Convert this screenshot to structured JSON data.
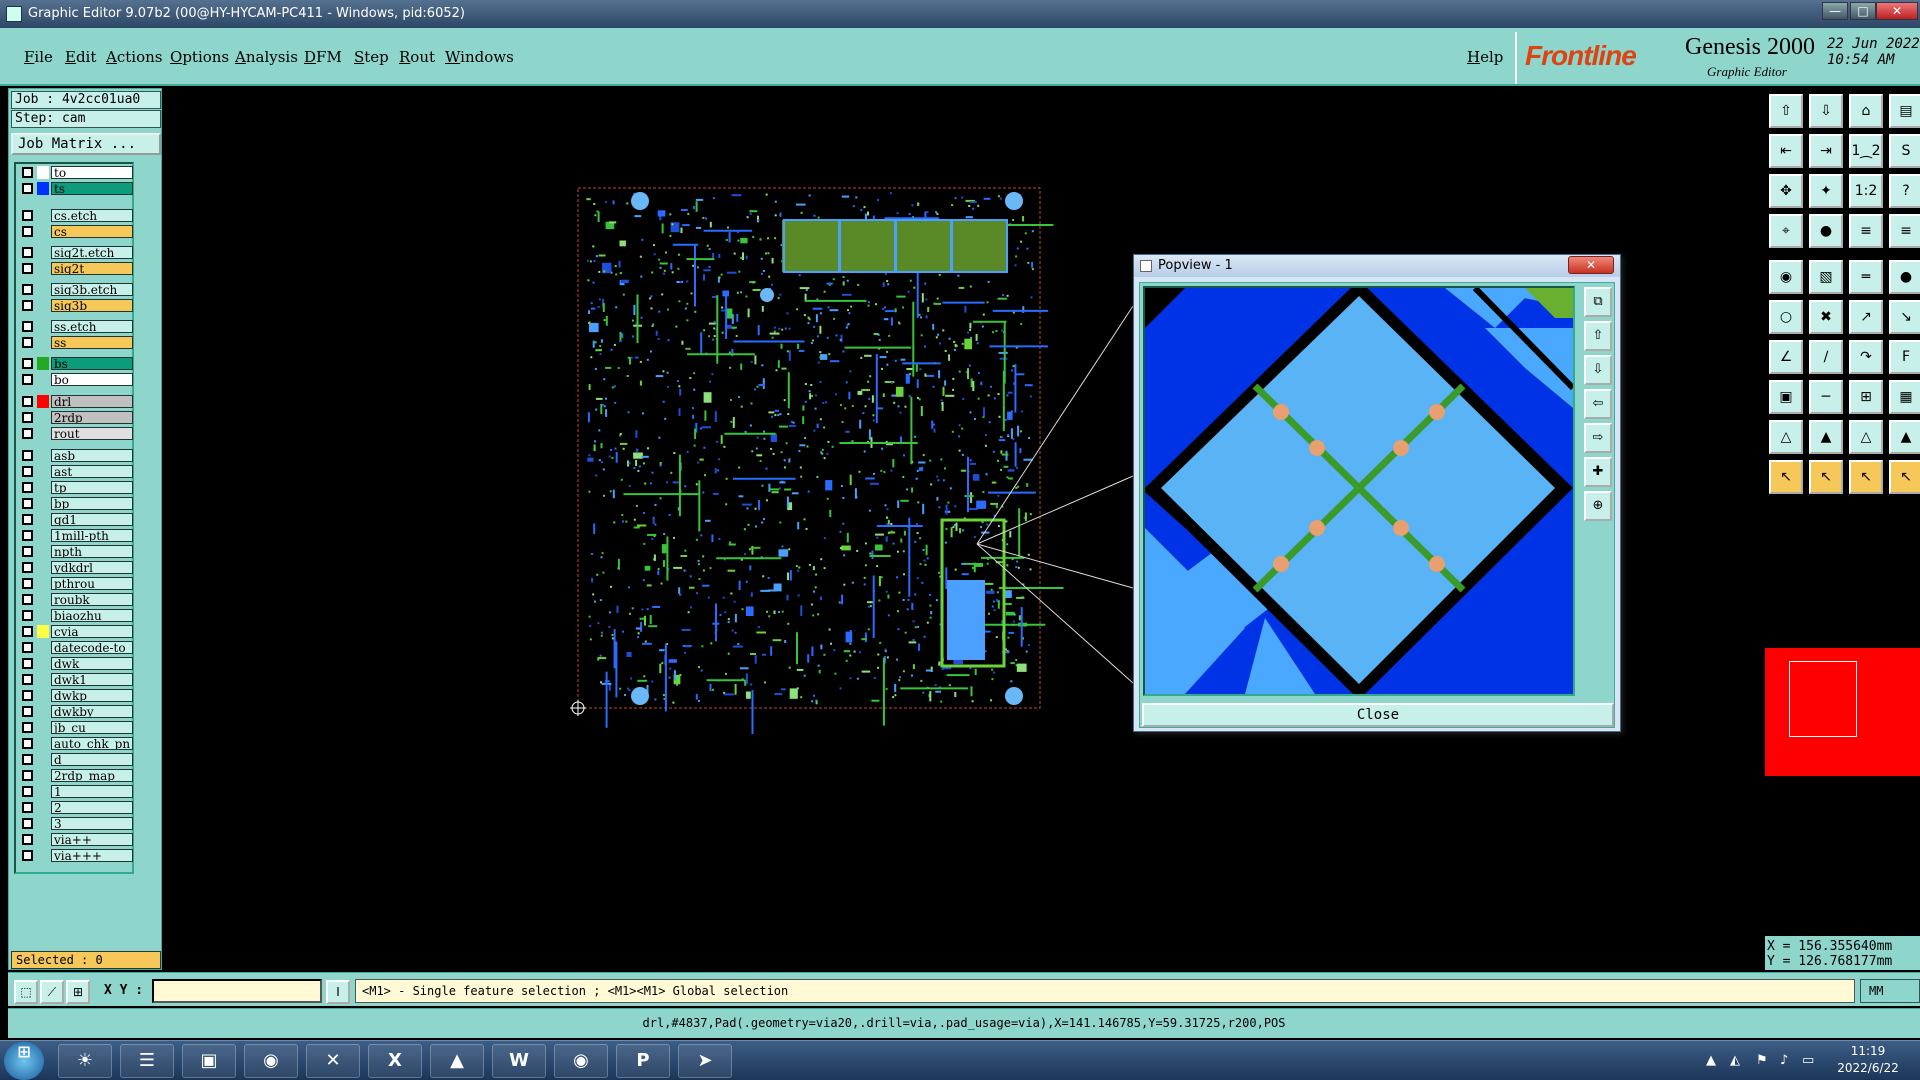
{
  "window": {
    "title": "Graphic Editor 9.07b2 (00@HY-HYCAM-PC411 - Windows, pid:6052)",
    "buttons": [
      "—",
      "□",
      "✕"
    ]
  },
  "menu": {
    "items": [
      "File",
      "Edit",
      "Actions",
      "Options",
      "Analysis",
      "DFM",
      "Step",
      "Rout",
      "Windows"
    ],
    "help": "Help"
  },
  "brand": {
    "logo": "Frontline",
    "product": "Genesis 2000",
    "subtitle": "Graphic Editor",
    "date": "22 Jun 2022",
    "time": "10:54 AM"
  },
  "job": {
    "job": "Job : 4v2cc01ua0",
    "step": "Step: cam",
    "matrix_button": "Job Matrix ..."
  },
  "layers": [
    {
      "name": "to",
      "swatch": "#ffffff",
      "bg": "#ffffff"
    },
    {
      "name": "ts",
      "swatch": "#0033ff",
      "bg": "#0c9c7c"
    },
    {
      "name": "cs.etch",
      "swatch": "",
      "bg": "#c8f0ea"
    },
    {
      "name": "cs",
      "swatch": "",
      "bg": "#f6c85a"
    },
    {
      "name": "sig2t.etch",
      "swatch": "",
      "bg": "#c8f0ea"
    },
    {
      "name": "sig2t",
      "swatch": "",
      "bg": "#f6c85a"
    },
    {
      "name": "sig3b.etch",
      "swatch": "",
      "bg": "#c8f0ea"
    },
    {
      "name": "sig3b",
      "swatch": "",
      "bg": "#f6c85a"
    },
    {
      "name": "ss.etch",
      "swatch": "",
      "bg": "#c8f0ea"
    },
    {
      "name": "ss",
      "swatch": "",
      "bg": "#f6c85a"
    },
    {
      "name": "bs",
      "swatch": "#22aa22",
      "bg": "#0c9c7c"
    },
    {
      "name": "bo",
      "swatch": "",
      "bg": "#ffffff"
    },
    {
      "name": "drl",
      "swatch": "#ff0000",
      "bg": "#c0c0c0"
    },
    {
      "name": "2rdp",
      "swatch": "",
      "bg": "#c0c0c0"
    },
    {
      "name": "rout",
      "swatch": "",
      "bg": "#e0e0e0"
    },
    {
      "name": "asb",
      "swatch": "",
      "bg": "#c8f0ea"
    },
    {
      "name": "ast",
      "swatch": "",
      "bg": "#c8f0ea"
    },
    {
      "name": "tp",
      "swatch": "",
      "bg": "#c8f0ea"
    },
    {
      "name": "bp",
      "swatch": "",
      "bg": "#c8f0ea"
    },
    {
      "name": "gd1",
      "swatch": "",
      "bg": "#c8f0ea"
    },
    {
      "name": "1mill-pth",
      "swatch": "",
      "bg": "#c8f0ea"
    },
    {
      "name": "npth",
      "swatch": "",
      "bg": "#c8f0ea"
    },
    {
      "name": "ydkdrl",
      "swatch": "",
      "bg": "#c8f0ea"
    },
    {
      "name": "pthrou",
      "swatch": "",
      "bg": "#c8f0ea"
    },
    {
      "name": "roubk",
      "swatch": "",
      "bg": "#c8f0ea"
    },
    {
      "name": "biaozhu",
      "swatch": "",
      "bg": "#c8f0ea"
    },
    {
      "name": "cvia",
      "swatch": "#ffff44",
      "bg": "#c8f0ea"
    },
    {
      "name": "datecode-to",
      "swatch": "",
      "bg": "#c8f0ea"
    },
    {
      "name": "dwk",
      "swatch": "",
      "bg": "#c8f0ea"
    },
    {
      "name": "dwk1",
      "swatch": "",
      "bg": "#c8f0ea"
    },
    {
      "name": "dwkp",
      "swatch": "",
      "bg": "#c8f0ea"
    },
    {
      "name": "dwkby",
      "swatch": "",
      "bg": "#c8f0ea"
    },
    {
      "name": "jb_cu",
      "swatch": "",
      "bg": "#c8f0ea"
    },
    {
      "name": "auto_chk_pn",
      "swatch": "",
      "bg": "#c8f0ea"
    },
    {
      "name": "d",
      "swatch": "",
      "bg": "#c8f0ea"
    },
    {
      "name": "2rdp_map",
      "swatch": "",
      "bg": "#c8f0ea"
    },
    {
      "name": "1",
      "swatch": "",
      "bg": "#c8f0ea"
    },
    {
      "name": "2",
      "swatch": "",
      "bg": "#c8f0ea"
    },
    {
      "name": "3",
      "swatch": "",
      "bg": "#c8f0ea"
    },
    {
      "name": "via++",
      "swatch": "",
      "bg": "#c8f0ea"
    },
    {
      "name": "via+++",
      "swatch": "",
      "bg": "#c8f0ea"
    }
  ],
  "selected": "Selected : 0",
  "popview": {
    "title": "Popview - 1",
    "close_label": "Close",
    "buttons": [
      "pv-fit",
      "pv-up",
      "pv-down",
      "pv-left",
      "pv-right",
      "pv-zoom-in",
      "pv-zoom-out"
    ]
  },
  "toolbar": {
    "icons": [
      "open-icon",
      "save-icon",
      "home-icon",
      "panel-icon",
      "step-left-icon",
      "step-right-icon",
      "two-up-icon",
      "snap-icon",
      "zoom-fit-icon",
      "zoom-home-icon",
      "scale-1-2-icon",
      "help-icon",
      "measure-icon",
      "pin-icon",
      "layers-red-icon",
      "layers-red2-icon",
      "pad-icon",
      "copy-shape-icon",
      "line-style-icon",
      "dot-icon",
      "node-icon",
      "cross-icon",
      "vector-icon",
      "arrow-icon",
      "angle-icon",
      "pen-icon",
      "arc-icon",
      "text-icon",
      "select-area-icon",
      "line-icon",
      "grid-icon",
      "layer-stack-icon",
      "triangle-icon",
      "triangle2-icon",
      "triangle3-icon",
      "triangle4-icon",
      "pointer-icon",
      "pointer2-icon",
      "pointer3-icon",
      "pointer4-icon"
    ],
    "labels": [
      "⇧",
      "⇩",
      "⌂",
      "▤",
      "⇤",
      "⇥",
      "1⁔2",
      "S",
      "✥",
      "✦",
      "1:2",
      "?",
      "⌖",
      "●",
      "≡",
      "≡",
      "◉",
      "▧",
      "═",
      "●",
      "○",
      "✖",
      "↗",
      "↘",
      "∠",
      "∕",
      "↷",
      "F",
      "▣",
      "─",
      "⊞",
      "▦",
      "△",
      "▲",
      "△",
      "▲",
      "↖",
      "↖",
      "↖",
      "↖"
    ],
    "coord_x": "X = 156.355640mm",
    "coord_y": "Y = 126.768177mm"
  },
  "command": {
    "xy_label": "X Y :",
    "xy_value": "",
    "message": "<M1> - Single feature selection ; <M1><M1> Global selection",
    "unit": "MM"
  },
  "status": "drl,#4837,Pad(.geometry=via20,.drill=via,.pad_usage=via),X=141.146785,Y=59.31725,r200,POS",
  "taskbar": {
    "time": "11:19",
    "date": "2022/6/22",
    "apps": [
      "☀",
      "☰",
      "▣",
      "◉",
      "✕",
      "X",
      "▲",
      "W",
      "◉",
      "P",
      "➤"
    ],
    "app_names": [
      "app-shell-icon",
      "app-notepad-icon",
      "app-disk-icon",
      "app-eye-icon",
      "app-genesis-icon",
      "app-excel-icon",
      "app-red-icon",
      "app-word-icon",
      "app-eye2-icon",
      "app-p-icon",
      "app-arrow-icon"
    ]
  }
}
